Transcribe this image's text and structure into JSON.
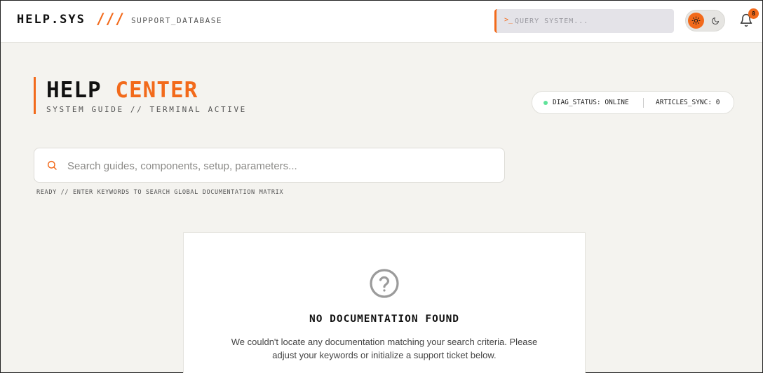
{
  "header": {
    "brand": "HELP.SYS",
    "slashes": "///",
    "subtitle": "SUPPORT_DATABASE",
    "query_prompt": ">_",
    "query_placeholder": "QUERY SYSTEM...",
    "notification_count": "8",
    "icons": {
      "theme_light": "sun-icon",
      "theme_dark": "moon-icon",
      "notifications": "bell-icon"
    }
  },
  "hero": {
    "title_part1": "HELP",
    "title_part2": "CENTER",
    "subtitle": "SYSTEM GUIDE // TERMINAL ACTIVE",
    "diag_status": "DIAG_STATUS: ONLINE",
    "articles_sync": "ARTICLES_SYNC: 0"
  },
  "search": {
    "placeholder": "Search guides, components, setup, parameters...",
    "value": "",
    "hint": "READY // ENTER KEYWORDS TO SEARCH GLOBAL DOCUMENTATION MATRIX"
  },
  "empty_state": {
    "icon": "question-circle-icon",
    "title": "NO DOCUMENTATION FOUND",
    "message": "We couldn't locate any documentation matching your search criteria. Please adjust your keywords or initialize a support ticket below."
  },
  "colors": {
    "accent": "#f26a1b",
    "background": "#f4f3ef",
    "status_online": "#5fe39a"
  }
}
